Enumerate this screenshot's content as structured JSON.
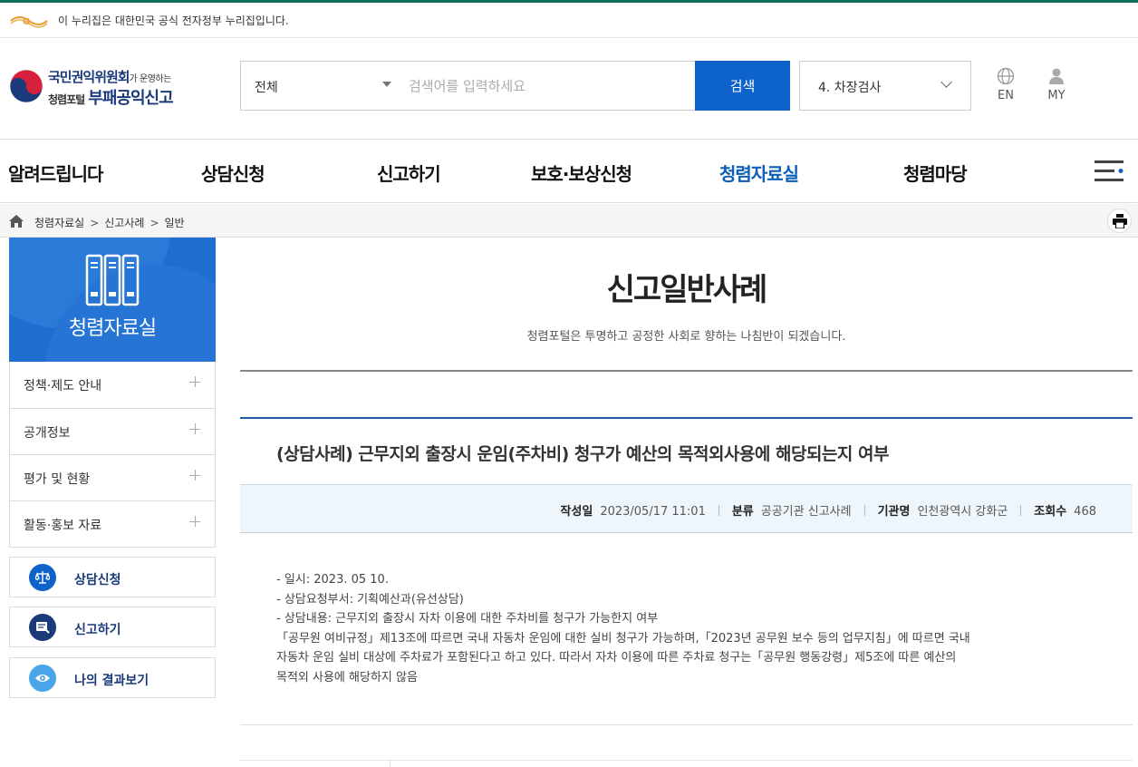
{
  "gov_banner": {
    "text": "이 누리집은 대한민국 공식 전자정부 누리집입니다."
  },
  "logo": {
    "line1_main": "국민권익위원회",
    "line1_small": "가 운영하는",
    "line2_small": "청렴포털",
    "line2_main": "부패공익신고"
  },
  "search": {
    "category": "전체",
    "placeholder": "검색어를 입력하세요",
    "button": "검색"
  },
  "popular_keyword": "4. 차장검사",
  "util": {
    "lang": "EN",
    "my": "MY"
  },
  "gnb": [
    "알려드립니다",
    "상담신청",
    "신고하기",
    "보호·보상신청",
    "청렴자료실",
    "청렴마당"
  ],
  "breadcrumb": [
    "청렴자료실",
    "신고사례",
    "일반"
  ],
  "sidebar": {
    "title": "청렴자료실",
    "items": [
      "정책·제도 안내",
      "공개정보",
      "평가 및 현황",
      "활동·홍보 자료"
    ],
    "quick": [
      "상담신청",
      "신고하기",
      "나의 결과보기"
    ]
  },
  "page": {
    "title": "신고일반사례",
    "desc": "청렴포털은 투명하고 공정한 사회로 향하는 나침반이 되겠습니다."
  },
  "post": {
    "title": "(상담사례) 근무지외 출장시 운임(주차비) 청구가 예산의 목적외사용에 해당되는지 여부",
    "meta": {
      "date_label": "작성일",
      "date": "2023/05/17 11:01",
      "cat_label": "분류",
      "cat": "공공기관 신고사례",
      "org_label": "기관명",
      "org": "인천광역시 강화군",
      "views_label": "조회수",
      "views": "468"
    },
    "body": [
      "- 일시: 2023. 05 10.",
      "- 상담요청부서: 기획예산과(유선상담)",
      "- 상담내용: 근무지외 출장시 자차 이용에 대한 주차비를 청구가 가능한지 여부",
      "「공무원 여비규정」제13조에 따르면 국내 자동차 운임에 대한 실비 청구가 가능하며,「2023년 공무원 보수 등의 업무지침」에 따르면 국내",
      "자동차 운임 실비 대상에 주차료가 포함된다고 하고 있다. 따라서 자차 이용에 따른 주차료 청구는「공무원 행동강령」제5조에 따른 예산의",
      "목적외 사용에 해당하지 않음"
    ]
  },
  "colors": {
    "brand_blue": "#0d63c9",
    "active_menu": "#0d5fb8",
    "gov_green": "#0f6b5a"
  }
}
